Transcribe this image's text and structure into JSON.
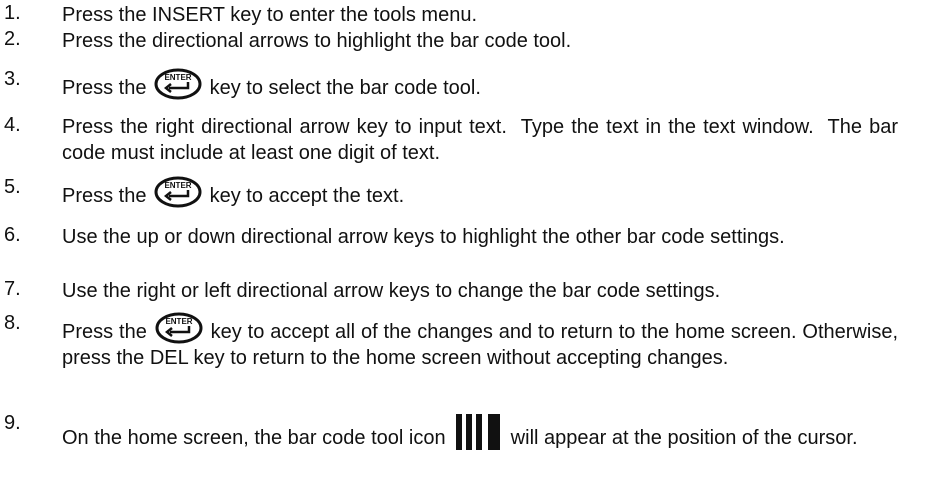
{
  "steps": [
    {
      "num": "1.",
      "text": "Press the INSERT key to enter the tools menu."
    },
    {
      "num": "2.",
      "text": "Press the directional arrows to highlight the bar code tool."
    },
    {
      "num": "3.",
      "before": "Press the ",
      "icon": "enter-key-icon",
      "icon_label": "ENTER",
      "after": " key to select the bar code tool."
    },
    {
      "num": "4.",
      "text": "Press the right directional arrow key to input text.  Type the text in the text window.  The bar code must include at least one digit of text."
    },
    {
      "num": "5.",
      "before": "Press the ",
      "icon": "enter-key-icon",
      "icon_label": "ENTER",
      "after": " key to accept the text."
    },
    {
      "num": "6.",
      "text": "Use the up or down directional arrow keys to highlight the other bar code settings."
    },
    {
      "num": "7.",
      "text": "Use the right or left directional arrow keys to change the bar code settings."
    },
    {
      "num": "8.",
      "before": "Press the ",
      "icon": "enter-key-icon",
      "icon_label": "ENTER",
      "after": " key to accept all of the changes and to return to the home screen. Otherwise, press the DEL key to return to the home screen without accepting changes."
    },
    {
      "num": "9.",
      "before": "On the home screen, the bar code tool icon ",
      "icon": "barcode-icon",
      "after": " will appear at the position of the cursor."
    }
  ]
}
